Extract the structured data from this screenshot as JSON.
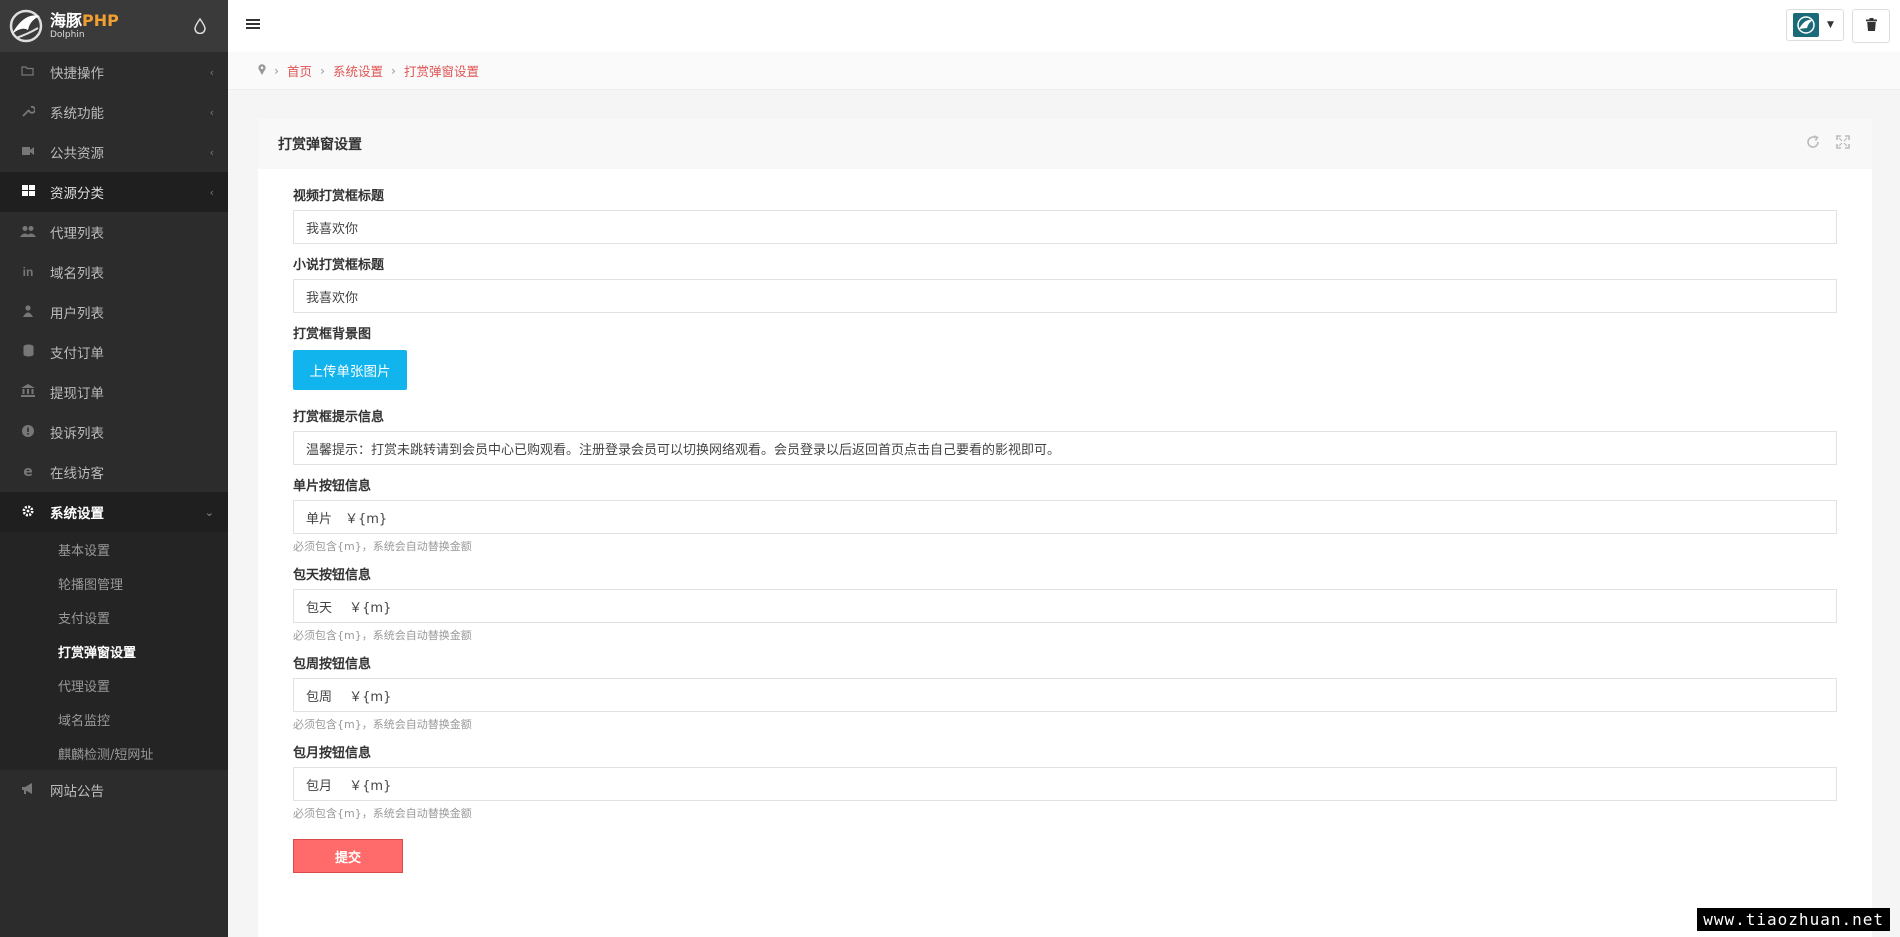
{
  "brand": {
    "name_cn": "海豚",
    "name_php": "PHP",
    "name_en": "Dolphin"
  },
  "colors": {
    "sidebar": "#2c2c2c",
    "accent_red": "#e05555",
    "upload_button": "#11b4ed",
    "submit_button": "#ff6b6b"
  },
  "sidebar": {
    "items": [
      {
        "label": "快捷操作",
        "icon": "folder-open-icon"
      },
      {
        "label": "系统功能",
        "icon": "wrench-icon"
      },
      {
        "label": "公共资源",
        "icon": "video-camera-icon"
      },
      {
        "label": "资源分类",
        "icon": "th-large-icon"
      },
      {
        "label": "代理列表",
        "icon": "users-icon"
      },
      {
        "label": "域名列表",
        "icon": "linkedin-icon"
      },
      {
        "label": "用户列表",
        "icon": "user-icon"
      },
      {
        "label": "支付订单",
        "icon": "database-icon"
      },
      {
        "label": "提现订单",
        "icon": "bank-icon"
      },
      {
        "label": "投诉列表",
        "icon": "exclamation-circle-icon"
      },
      {
        "label": "在线访客",
        "icon": "ie-icon"
      },
      {
        "label": "系统设置",
        "icon": "gear-icon"
      },
      {
        "label": "网站公告",
        "icon": "bullhorn-icon"
      }
    ],
    "sub_items": [
      "基本设置",
      "轮播图管理",
      "支付设置",
      "打赏弹窗设置",
      "代理设置",
      "域名监控",
      "麒麟检测/短网址"
    ]
  },
  "breadcrumb": {
    "home": "首页",
    "level1": "系统设置",
    "current": "打赏弹窗设置"
  },
  "block": {
    "title": "打赏弹窗设置"
  },
  "form": {
    "video_title": {
      "label": "视频打赏框标题",
      "value": "我喜欢你"
    },
    "novel_title": {
      "label": "小说打赏框标题",
      "value": "我喜欢你"
    },
    "bg_image": {
      "label": "打赏框背景图",
      "button": "上传单张图片"
    },
    "tip": {
      "label": "打赏框提示信息",
      "value": "温馨提示：打赏未跳转请到会员中心已购观看。注册登录会员可以切换网络观看。会员登录以后返回首页点击自己要看的影视即可。"
    },
    "single": {
      "label": "单片按钮信息",
      "value": "单片　￥{m}",
      "help": "必须包含{m}，系统会自动替换金额"
    },
    "day": {
      "label": "包天按钮信息",
      "value": "包天　 ￥{m}",
      "help": "必须包含{m}，系统会自动替换金额"
    },
    "week": {
      "label": "包周按钮信息",
      "value": "包周　 ￥{m}",
      "help": "必须包含{m}，系统会自动替换金额"
    },
    "month": {
      "label": "包月按钮信息",
      "value": "包月　 ￥{m}",
      "help": "必须包含{m}，系统会自动替换金额"
    },
    "submit": "提交"
  },
  "watermark": "www.tiaozhuan.net"
}
